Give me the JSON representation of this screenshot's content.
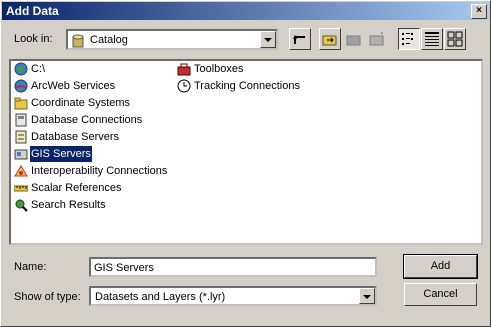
{
  "window": {
    "title": "Add Data",
    "close_glyph": "×"
  },
  "lookin": {
    "label": "Look in:",
    "value": "Catalog",
    "icon": "catalog-icon"
  },
  "toolbar": [
    "up-one-level-icon",
    "connect-to-folder-icon",
    "disconnect-icon",
    "new-folder-icon",
    "list-view-icon",
    "details-view-icon",
    "thumbnails-view-icon"
  ],
  "items": [
    {
      "label": "C:\\",
      "icon": "drive-icon"
    },
    {
      "label": "ArcWeb Services",
      "icon": "arcweb-icon"
    },
    {
      "label": "Coordinate Systems",
      "icon": "folder-icon"
    },
    {
      "label": "Database Connections",
      "icon": "database-icon"
    },
    {
      "label": "Database Servers",
      "icon": "database-servers-icon"
    },
    {
      "label": "GIS Servers",
      "icon": "gis-servers-icon",
      "selected": true
    },
    {
      "label": "Interoperability Connections",
      "icon": "interop-icon"
    },
    {
      "label": "Scalar References",
      "icon": "ruler-icon"
    },
    {
      "label": "Search Results",
      "icon": "search-results-icon"
    },
    {
      "label": "Toolboxes",
      "icon": "toolbox-icon"
    },
    {
      "label": "Tracking Connections",
      "icon": "clock-icon"
    }
  ],
  "name_field": {
    "label": "Name:",
    "value": "GIS Servers"
  },
  "type_field": {
    "label": "Show of type:",
    "value": "Datasets and Layers (*.lyr)"
  },
  "buttons": {
    "add": "Add",
    "cancel": "Cancel"
  }
}
